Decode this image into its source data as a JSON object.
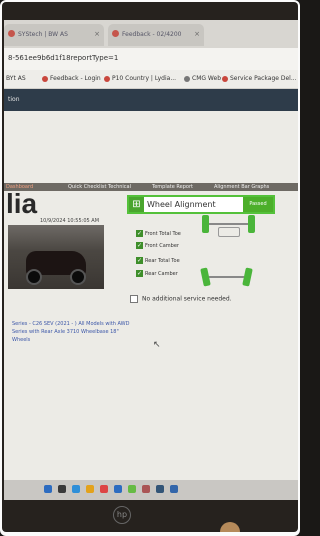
{
  "browser": {
    "tabs": [
      {
        "label": "SYStech | BW AS"
      },
      {
        "label": "Feedback - 02/4200"
      }
    ],
    "url": "8-561ee9b6d1f18reportType=1",
    "bookmarks": [
      {
        "label": "BYt AS"
      },
      {
        "label": "Feedback - Login"
      },
      {
        "label": "P10 Country | Lydia..."
      },
      {
        "label": "CMG Web"
      },
      {
        "label": "Service Package Del..."
      }
    ]
  },
  "app": {
    "nav_label": "tion",
    "subtabs": [
      {
        "label": "Dashboard",
        "active": true
      },
      {
        "label": "Quick Checklist Technical"
      },
      {
        "label": "Template Report"
      },
      {
        "label": "Alignment Bar Graphs"
      }
    ],
    "title": "lia",
    "date": "10/9/2024 10:55:05 AM",
    "vehicle_text": "Series - C26 SEV (2021 - ) All Models with AWD Series with Rear Axle 3710 Wheelbase 18\" Wheels",
    "wheel_alignment": {
      "label": "Wheel Alignment",
      "button_label": "Passed"
    },
    "checks": [
      {
        "label": "Front Total Toe",
        "checked": true
      },
      {
        "label": "Front Camber",
        "checked": true
      },
      {
        "label": "Rear Total Toe",
        "checked": true
      },
      {
        "label": "Rear Camber",
        "checked": true
      }
    ],
    "no_additional": {
      "label": "No additional service needed.",
      "checked": false
    }
  },
  "colors": {
    "accent_green": "#4caf2a",
    "appbar": "#2e3c4a",
    "link_blue": "#3c57a8"
  },
  "icons": [
    "favicon-icon",
    "alignment-icon",
    "checkbox-icon",
    "cursor-icon",
    "hp-logo-icon"
  ]
}
